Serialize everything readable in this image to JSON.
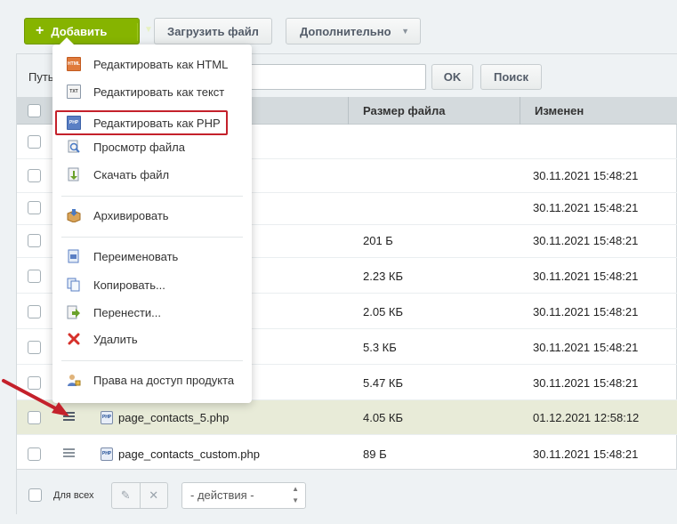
{
  "toolbar": {
    "add_label": "Добавить",
    "upload_label": "Загрузить файл",
    "more_label": "Дополнительно"
  },
  "pathbar": {
    "label": "Путь",
    "ok_label": "OK",
    "search_label": "Поиск"
  },
  "table": {
    "columns": [
      "Размер файла",
      "Изменен"
    ],
    "rows": [
      {
        "name": "",
        "size": "",
        "modified": ""
      },
      {
        "name": "",
        "size": "",
        "modified": "30.11.2021 15:48:21"
      },
      {
        "name": "",
        "size": "",
        "modified": "30.11.2021 15:48:21"
      },
      {
        "name": "",
        "size": "201 Б",
        "modified": "30.11.2021 15:48:21"
      },
      {
        "name": "",
        "size": "2.23 КБ",
        "modified": "30.11.2021 15:48:21"
      },
      {
        "name": "",
        "size": "2.05 КБ",
        "modified": "30.11.2021 15:48:21"
      },
      {
        "name": "",
        "size": "5.3 КБ",
        "modified": "30.11.2021 15:48:21"
      },
      {
        "name": "",
        "size": "5.47 КБ",
        "modified": "30.11.2021 15:48:21"
      },
      {
        "name": "page_contacts_5.php",
        "size": "4.05 КБ",
        "modified": "01.12.2021 12:58:12"
      },
      {
        "name": "page_contacts_custom.php",
        "size": "89 Б",
        "modified": "30.11.2021 15:48:21"
      }
    ]
  },
  "footer": {
    "for_all_label": "Для всех",
    "actions_placeholder": "- действия -"
  },
  "menu": {
    "items": [
      {
        "label": "Редактировать как HTML",
        "icon": "html-file-icon"
      },
      {
        "label": "Редактировать как текст",
        "icon": "txt-file-icon"
      },
      {
        "label": "Редактировать как PHP",
        "icon": "php-file-icon"
      },
      {
        "label": "Просмотр файла",
        "icon": "view-file-icon"
      },
      {
        "label": "Скачать файл",
        "icon": "download-icon"
      },
      {
        "label": "Архивировать",
        "icon": "archive-icon"
      },
      {
        "label": "Переименовать",
        "icon": "rename-icon"
      },
      {
        "label": "Копировать...",
        "icon": "copy-icon"
      },
      {
        "label": "Перенести...",
        "icon": "move-icon"
      },
      {
        "label": "Удалить",
        "icon": "delete-icon"
      },
      {
        "label": "Права на доступ продукта",
        "icon": "access-rights-icon"
      }
    ],
    "icon_labels": {
      "html": "HTML",
      "txt": "TXT",
      "php": "PHP"
    }
  },
  "colors": {
    "accent_green": "#86b400",
    "highlight_red": "#c4212b",
    "selected_row": "#e8ebd8"
  }
}
